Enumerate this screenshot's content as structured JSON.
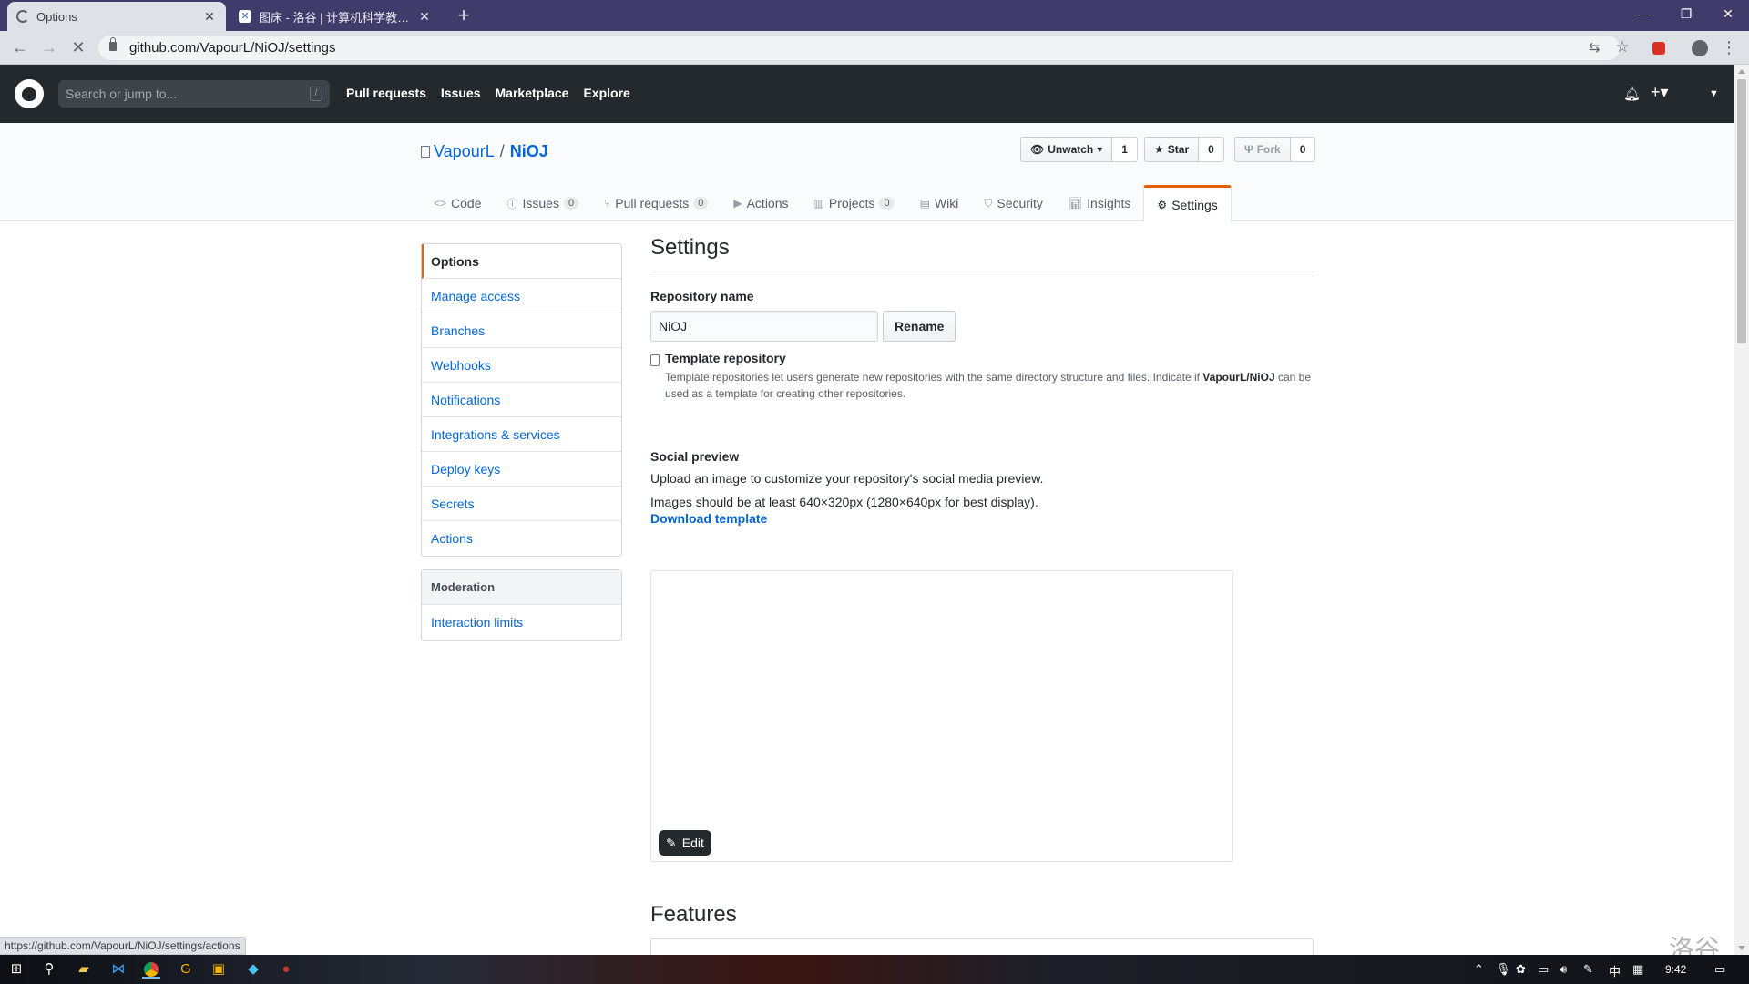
{
  "browser": {
    "tabs": [
      {
        "title": "Options"
      },
      {
        "title": "图床 - 洛谷 | 计算机科学教育新生态"
      }
    ],
    "url": "github.com/VapourL/NiOJ/settings",
    "status_url": "https://github.com/VapourL/NiOJ/settings/actions"
  },
  "gh_header": {
    "search_placeholder": "Search or jump to...",
    "slash_hint": "/",
    "nav": [
      "Pull requests",
      "Issues",
      "Marketplace",
      "Explore"
    ]
  },
  "repo": {
    "owner": "VapourL",
    "name": "NiOJ",
    "watch_label": "Unwatch",
    "watch_count": "1",
    "star_label": "Star",
    "star_count": "0",
    "fork_label": "Fork",
    "fork_count": "0",
    "tabs": [
      {
        "label": "Code",
        "count": null,
        "icon": "code-icon"
      },
      {
        "label": "Issues",
        "count": "0",
        "icon": "issue-icon"
      },
      {
        "label": "Pull requests",
        "count": "0",
        "icon": "pull-request-icon"
      },
      {
        "label": "Actions",
        "count": null,
        "icon": "play-icon"
      },
      {
        "label": "Projects",
        "count": "0",
        "icon": "project-icon"
      },
      {
        "label": "Wiki",
        "count": null,
        "icon": "book-icon"
      },
      {
        "label": "Security",
        "count": null,
        "icon": "shield-icon"
      },
      {
        "label": "Insights",
        "count": null,
        "icon": "graph-icon"
      },
      {
        "label": "Settings",
        "count": null,
        "icon": "gear-icon"
      }
    ]
  },
  "sidebar": {
    "items": [
      "Options",
      "Manage access",
      "Branches",
      "Webhooks",
      "Notifications",
      "Integrations & services",
      "Deploy keys",
      "Secrets",
      "Actions"
    ],
    "moderation_heading": "Moderation",
    "moderation_items": [
      "Interaction limits"
    ]
  },
  "settings": {
    "title": "Settings",
    "repo_name_label": "Repository name",
    "repo_name_value": "NiOJ",
    "rename_button": "Rename",
    "template_label": "Template repository",
    "template_note_before": "Template repositories let users generate new repositories with the same directory structure and files. Indicate if ",
    "template_note_repo": "VapourL/NiOJ",
    "template_note_after": " can be used as a template for creating other repositories.",
    "social_preview_label": "Social preview",
    "social_preview_desc": "Upload an image to customize your repository's social media preview.",
    "social_preview_size": "Images should be at least 640×320px (1280×640px for best display).",
    "download_template": "Download template",
    "edit_button": "Edit",
    "features_title": "Features"
  },
  "watermark": "洛谷",
  "taskbar": {
    "tray_ime": "中",
    "clock": "9:42"
  }
}
